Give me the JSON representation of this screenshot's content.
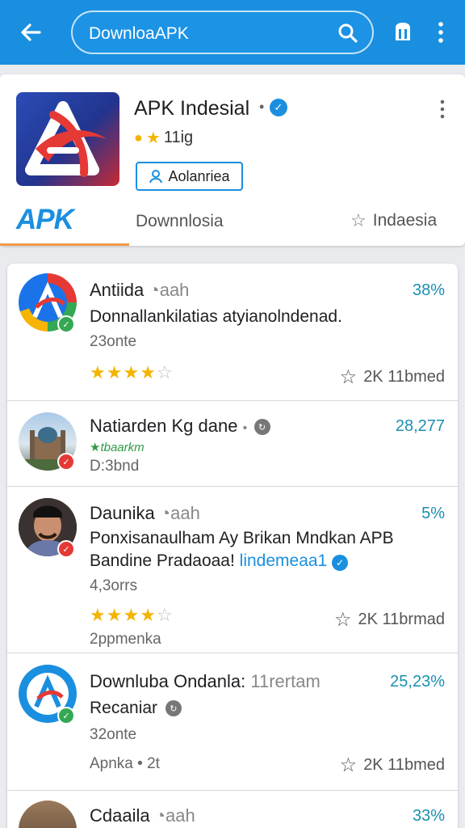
{
  "topbar": {
    "search_text": "DownloaAPK",
    "icons": [
      "back-arrow-icon",
      "search-icon",
      "store-icon",
      "more-vert-icon"
    ],
    "color": "#1a8fe0"
  },
  "featured": {
    "title": "APK Indesial",
    "rating": "11ig",
    "install_label": "Aolanriea",
    "brand": "APK",
    "subtitle": "Downnlosia",
    "region": "Indaesia"
  },
  "items": [
    {
      "name": "Antiida",
      "tag": "aah",
      "percent": "38%",
      "desc": "Donnallankilatias atyianolndenad.",
      "meta": "23onte",
      "rating": 4,
      "downloads": "2K 11bmed",
      "badge": "green"
    },
    {
      "name": "Natiarden Kg dane",
      "percent": "28,277",
      "green_text": "tbaarkm",
      "meta": "D:3bnd",
      "badge": "red"
    },
    {
      "name": "Daunika",
      "tag": "aah",
      "percent": "5%",
      "desc": "Ponxisanaulham Ay Brikan Mndkan APB",
      "desc2": "Bandine Pradaoaa!",
      "link": "lindemeaa1",
      "meta": "4,3orrs",
      "rating": 4,
      "downloads": "2K 11brmad",
      "footer": "2ppmenka",
      "badge": "red"
    },
    {
      "name": "Downluba Ondanla:",
      "tag": "11rertam",
      "percent": "25,23%",
      "desc": "Recaniar",
      "meta": "32onte",
      "footer": "Apnka • 2t",
      "downloads": "2K 11bmed",
      "badge": "green"
    },
    {
      "name": "Cdaaila",
      "tag": "aah",
      "percent": "33%"
    }
  ]
}
